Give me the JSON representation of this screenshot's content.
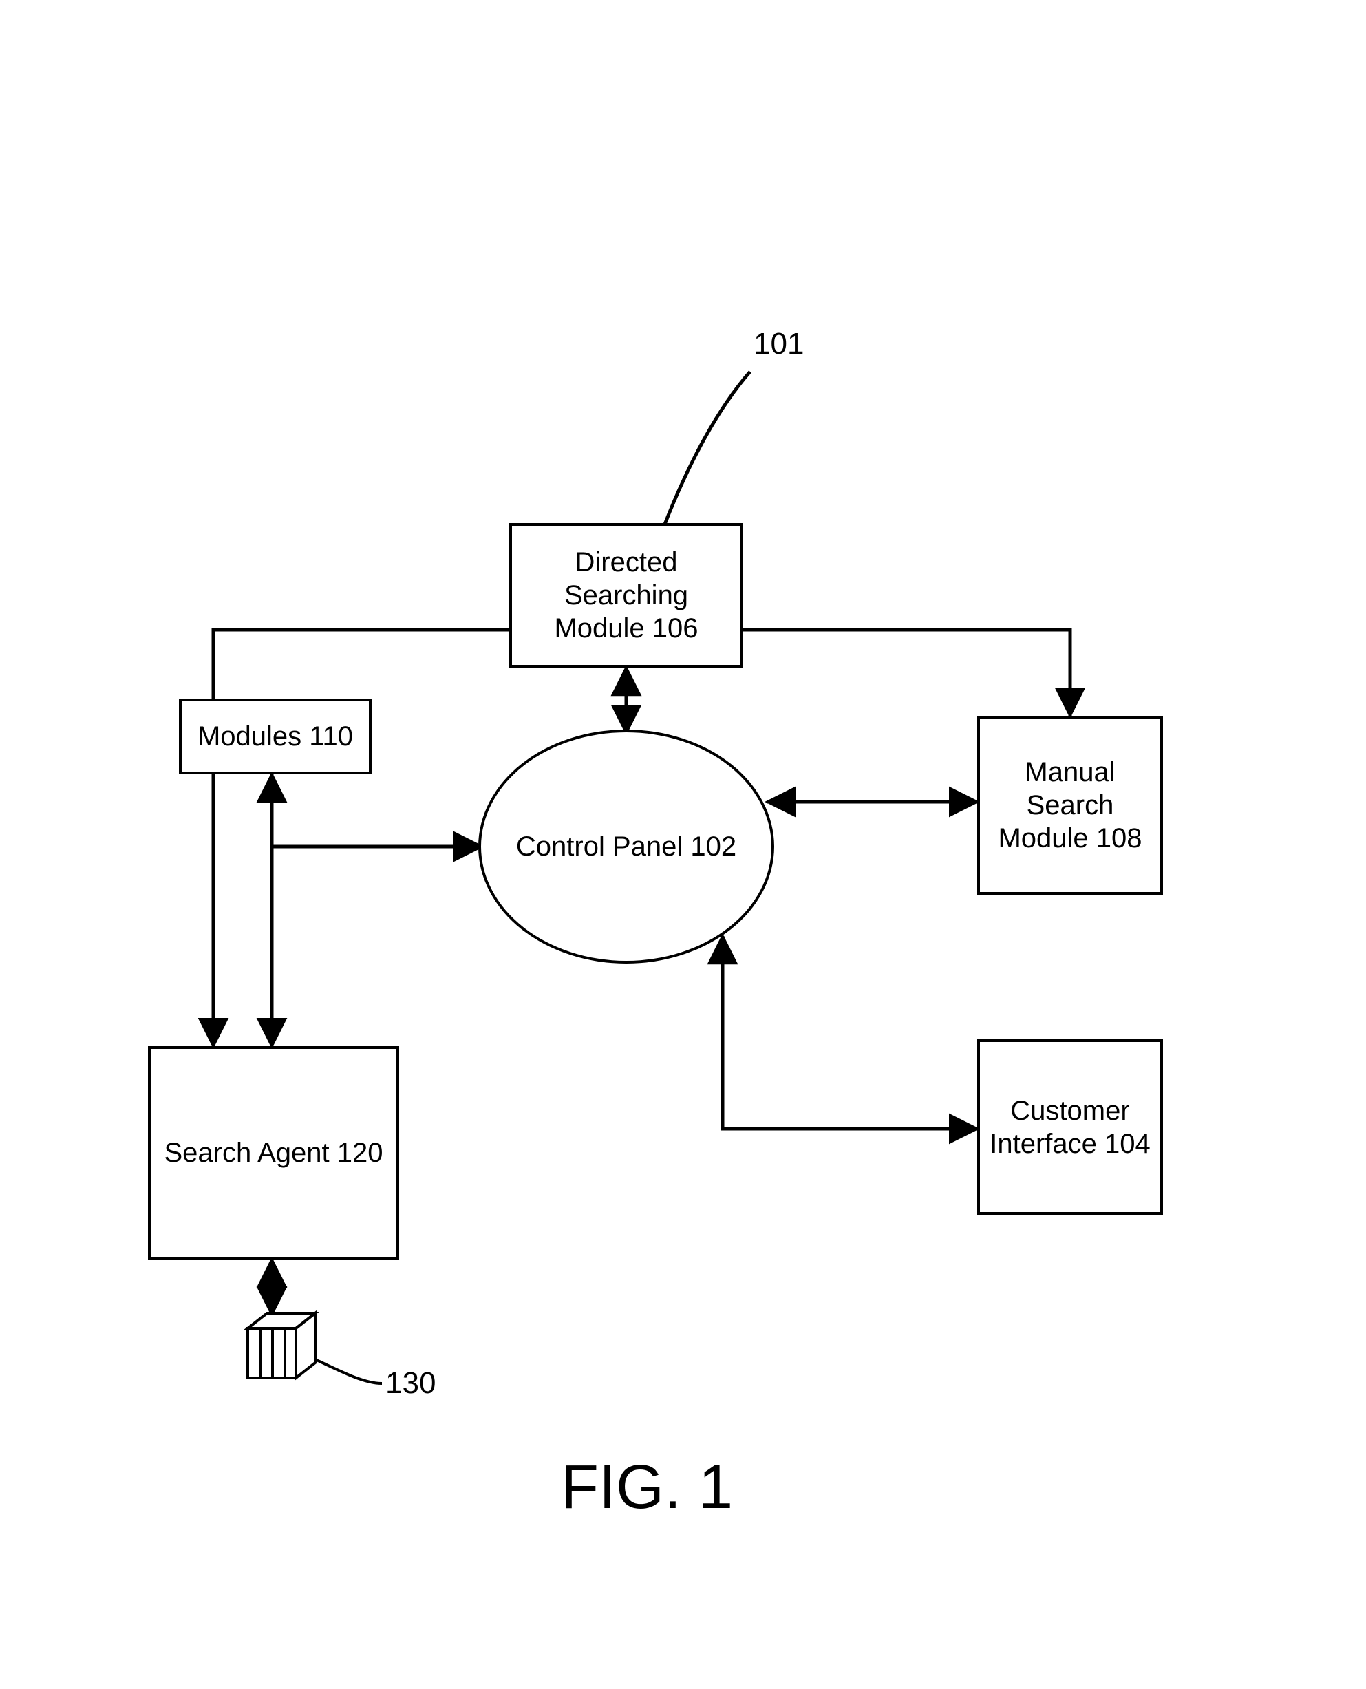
{
  "figure_label": "FIG. 1",
  "system_ref": "101",
  "nodes": {
    "control_panel": "Control Panel 102",
    "directed_searching_module": "Directed Searching Module 106",
    "manual_search_module": "Manual Search Module 108",
    "customer_interface": "Customer Interface 104",
    "modules": "Modules 110",
    "search_agent": "Search Agent 120",
    "server_ref": "130"
  },
  "chart_data": {
    "type": "diagram",
    "title": "FIG. 1",
    "nodes": [
      {
        "id": "101",
        "label": "101 (system reference)",
        "shape": "callout"
      },
      {
        "id": "102",
        "label": "Control Panel 102",
        "shape": "ellipse"
      },
      {
        "id": "104",
        "label": "Customer Interface 104",
        "shape": "rect"
      },
      {
        "id": "106",
        "label": "Directed Searching Module 106",
        "shape": "rect"
      },
      {
        "id": "108",
        "label": "Manual Search Module 108",
        "shape": "rect"
      },
      {
        "id": "110",
        "label": "Modules 110",
        "shape": "rect"
      },
      {
        "id": "120",
        "label": "Search Agent 120",
        "shape": "rect"
      },
      {
        "id": "130",
        "label": "130 (server icon)",
        "shape": "icon"
      }
    ],
    "edges": [
      {
        "from": "102",
        "to": "106",
        "dir": "both"
      },
      {
        "from": "102",
        "to": "108",
        "dir": "both"
      },
      {
        "from": "102",
        "to": "104",
        "dir": "both"
      },
      {
        "from": "102",
        "to": "110",
        "dir": "both"
      },
      {
        "from": "102",
        "to": "120",
        "dir": "both",
        "via": "110-junction"
      },
      {
        "from": "108",
        "to": "120",
        "dir": "both",
        "note": "routed above and left"
      },
      {
        "from": "120",
        "to": "130",
        "dir": "both"
      }
    ]
  }
}
